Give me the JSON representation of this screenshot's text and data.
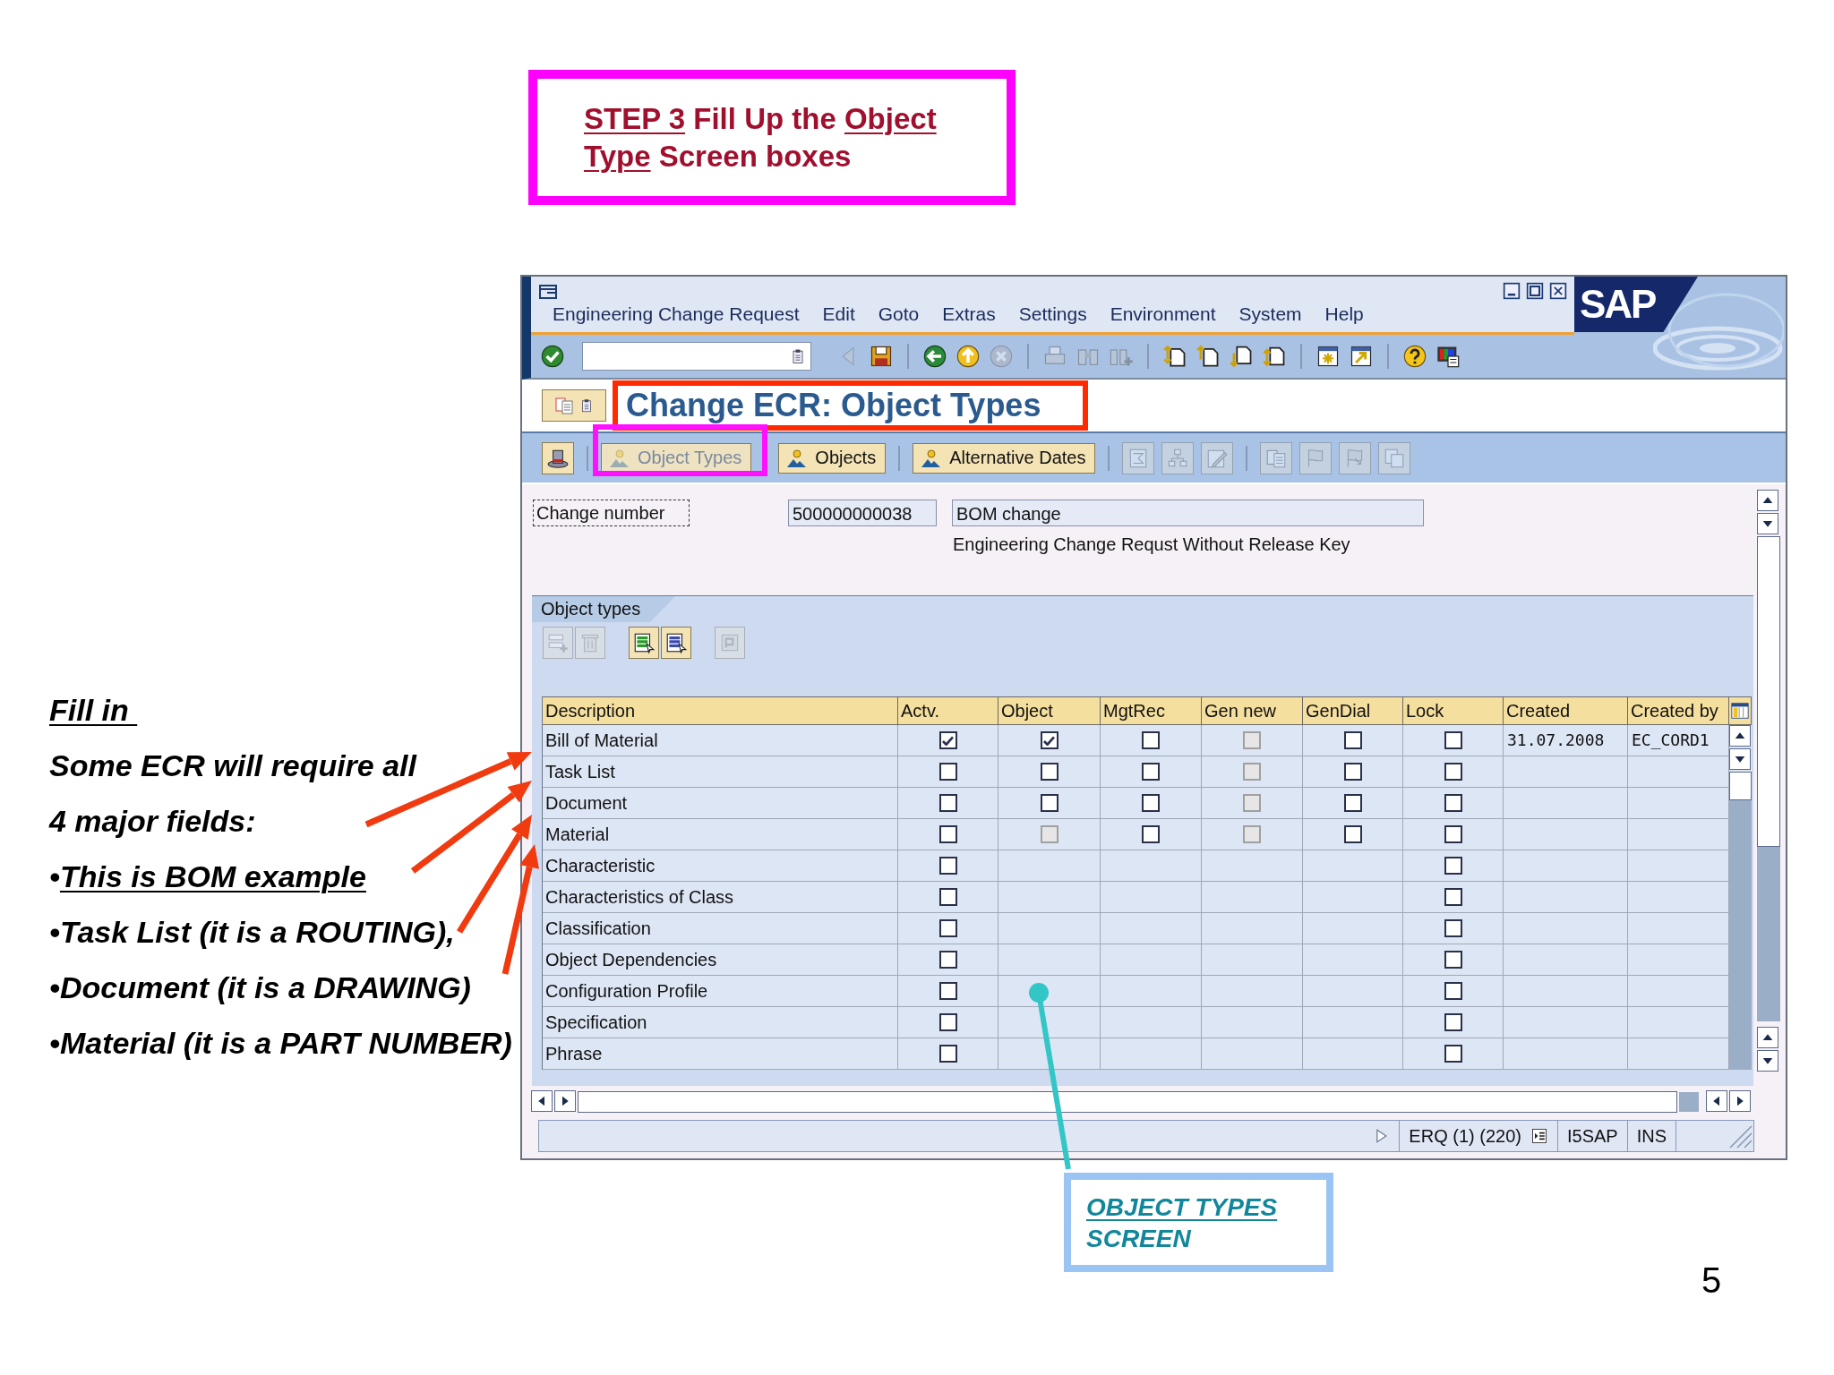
{
  "callout": {
    "lines": [
      [
        {
          "text": "STEP 3",
          "underline": true
        },
        {
          "text": " Fill Up the ",
          "underline": false
        },
        {
          "text": "Object",
          "underline": true
        }
      ],
      [
        {
          "text": "Type",
          "underline": true
        },
        {
          "text": " Screen boxes",
          "underline": false
        }
      ]
    ]
  },
  "notes": [
    {
      "text": "Fill in ",
      "underline": true
    },
    {
      "text": "Some ECR will require all",
      "underline": false
    },
    {
      "text": "4 major fields:",
      "underline": false
    },
    {
      "bullet": "•",
      "text": "This is BOM example",
      "underline": true
    },
    {
      "bullet": "•",
      "text": "Task List (it is a ROUTING),",
      "underline": false
    },
    {
      "bullet": "•",
      "text": "Document (it is a DRAWING)",
      "underline": false
    },
    {
      "bullet": "•",
      "text": "Material (it is a PART NUMBER)",
      "underline": false
    }
  ],
  "sap_window": {
    "menu": [
      "Engineering Change Request",
      "Edit",
      "Goto",
      "Extras",
      "Settings",
      "Environment",
      "System",
      "Help"
    ],
    "logo": "SAP",
    "toolbar": {
      "icons": [
        {
          "disabled": false
        },
        {
          "disabled": true
        },
        {
          "disabled": false
        },
        {
          "disabled": false
        },
        {
          "disabled": false
        },
        {
          "disabled": true
        },
        {
          "disabled": true
        },
        {
          "disabled": true
        },
        {
          "disabled": true
        },
        {
          "disabled": false
        },
        {
          "disabled": false
        },
        {
          "disabled": false
        },
        {
          "disabled": false
        },
        {
          "disabled": false
        },
        {
          "disabled": false
        },
        {
          "disabled": false
        },
        {
          "disabled": false
        }
      ]
    },
    "title": "Change ECR: Object Types",
    "app_toolbar": {
      "buttons": [
        {
          "label": "Object Types",
          "disabled": true
        },
        {
          "label": "Objects",
          "disabled": false
        },
        {
          "label": "Alternative Dates",
          "disabled": false
        }
      ],
      "icon_buttons": [
        {
          "disabled": true
        },
        {
          "disabled": true
        },
        {
          "disabled": true
        },
        {
          "disabled": true
        },
        {
          "disabled": true
        },
        {
          "disabled": true
        },
        {
          "disabled": true
        }
      ]
    },
    "header": {
      "label": "Change number",
      "number": "500000000038",
      "short_text": "BOM change",
      "type_text": "Engineering Change Requst Without Release Key"
    },
    "panel": {
      "title": "Object types",
      "icon_buttons": [
        {
          "disabled": true
        },
        {
          "disabled": true
        },
        {
          "disabled": false
        },
        {
          "disabled": false
        },
        {
          "disabled": true
        }
      ]
    },
    "table": {
      "columns": [
        "Description",
        "Actv.",
        "Object",
        "MgtRec",
        "Gen new",
        "GenDial",
        "Lock",
        "Created",
        "Created by"
      ],
      "rows": [
        {
          "description": "Bill of Material",
          "actv": {
            "checked": true,
            "disabled": false
          },
          "object": {
            "checked": true,
            "disabled": false
          },
          "mgtrec": {
            "checked": false,
            "disabled": false
          },
          "gen_new": {
            "checked": false,
            "disabled": true
          },
          "gendial": {
            "checked": false,
            "disabled": false
          },
          "lock": {
            "checked": false,
            "disabled": false
          },
          "created": "31.07.2008",
          "created_by": "EC_CORD1"
        },
        {
          "description": "Task List",
          "actv": {
            "checked": false,
            "disabled": false
          },
          "object": {
            "checked": false,
            "disabled": false
          },
          "mgtrec": {
            "checked": false,
            "disabled": false
          },
          "gen_new": {
            "checked": false,
            "disabled": true
          },
          "gendial": {
            "checked": false,
            "disabled": false
          },
          "lock": {
            "checked": false,
            "disabled": false
          }
        },
        {
          "description": "Document",
          "actv": {
            "checked": false,
            "disabled": false
          },
          "object": {
            "checked": false,
            "disabled": false
          },
          "mgtrec": {
            "checked": false,
            "disabled": false
          },
          "gen_new": {
            "checked": false,
            "disabled": true
          },
          "gendial": {
            "checked": false,
            "disabled": false
          },
          "lock": {
            "checked": false,
            "disabled": false
          }
        },
        {
          "description": "Material",
          "actv": {
            "checked": false,
            "disabled": false
          },
          "object": {
            "checked": false,
            "disabled": true
          },
          "mgtrec": {
            "checked": false,
            "disabled": false
          },
          "gen_new": {
            "checked": false,
            "disabled": true
          },
          "gendial": {
            "checked": false,
            "disabled": false
          },
          "lock": {
            "checked": false,
            "disabled": false
          }
        },
        {
          "description": "Characteristic",
          "actv": {
            "checked": false,
            "disabled": false
          },
          "lock": {
            "checked": false,
            "disabled": false
          }
        },
        {
          "description": "Characteristics of Class",
          "actv": {
            "checked": false,
            "disabled": false
          },
          "lock": {
            "checked": false,
            "disabled": false
          }
        },
        {
          "description": "Classification",
          "actv": {
            "checked": false,
            "disabled": false
          },
          "lock": {
            "checked": false,
            "disabled": false
          }
        },
        {
          "description": "Object Dependencies",
          "actv": {
            "checked": false,
            "disabled": false
          },
          "lock": {
            "checked": false,
            "disabled": false
          }
        },
        {
          "description": "Configuration Profile",
          "actv": {
            "checked": false,
            "disabled": false
          },
          "lock": {
            "checked": false,
            "disabled": false
          }
        },
        {
          "description": "Specification",
          "actv": {
            "checked": false,
            "disabled": false
          },
          "lock": {
            "checked": false,
            "disabled": false
          }
        },
        {
          "description": "Phrase",
          "actv": {
            "checked": false,
            "disabled": false
          },
          "lock": {
            "checked": false,
            "disabled": false
          }
        }
      ]
    },
    "status_bar": {
      "session": "ERQ (1) (220)",
      "server": "I5SAP",
      "mode": "INS"
    }
  },
  "screen_callout": {
    "lines": [
      [
        {
          "text": "OBJECT TYPES",
          "underline": true
        }
      ],
      [
        {
          "text": "SCREEN",
          "underline": false
        }
      ]
    ]
  },
  "page_number": "5"
}
